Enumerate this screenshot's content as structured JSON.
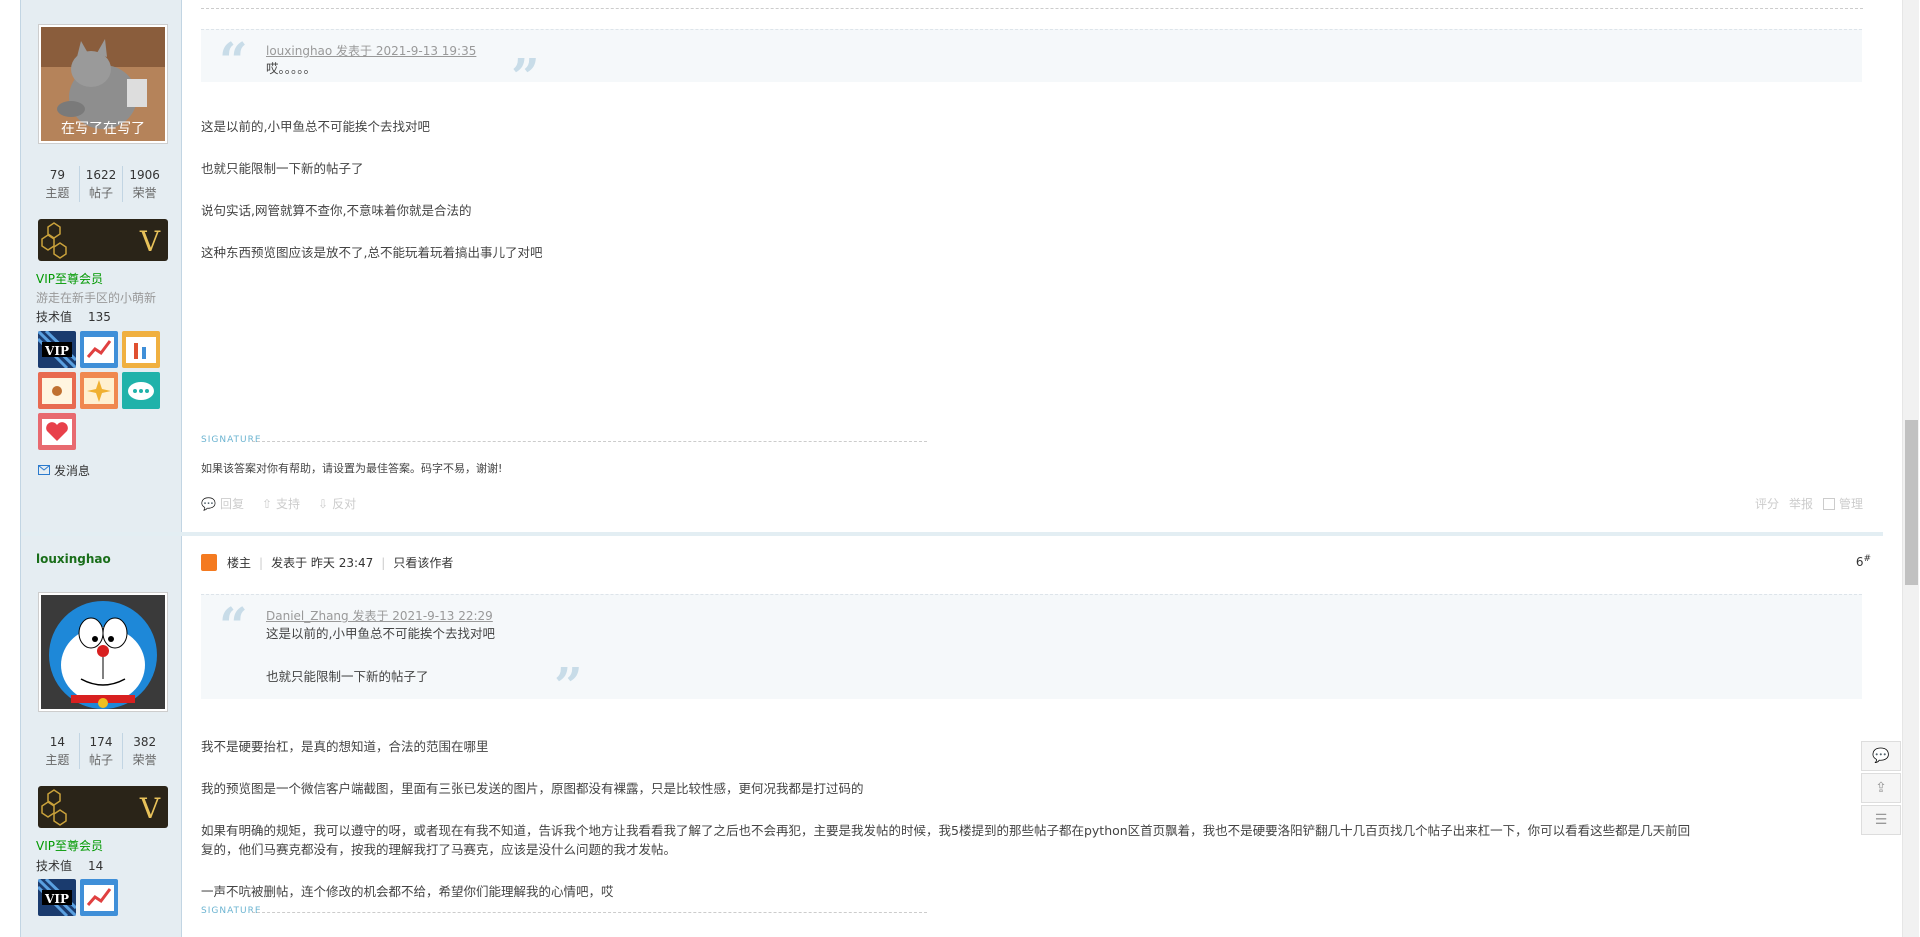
{
  "post_a": {
    "avatar_caption": "在写了在写了",
    "stats": [
      {
        "num": "79",
        "label": "主题"
      },
      {
        "num": "1622",
        "label": "帖子"
      },
      {
        "num": "1906",
        "label": "荣誉"
      }
    ],
    "vip_letter": "V",
    "group": "VIP至尊会员",
    "motto": "游走在新手区的小萌新",
    "tech_label": "技术值",
    "tech_value": "135",
    "medals": [
      "VIP",
      "chart",
      "rank",
      "tag",
      "star",
      "chat",
      "heart"
    ],
    "send_message": "发消息",
    "quote": {
      "header": "louxinghao 发表于 2021-9-13 19:35",
      "lines": [
        "哎。。。。。"
      ]
    },
    "paragraphs": [
      "这是以前的,小甲鱼总不可能挨个去找对吧",
      "也就只能限制一下新的帖子了",
      "说句实话,网管就算不查你,不意味着你就是合法的",
      "这种东西预览图应该是放不了,总不能玩着玩着搞出事儿了对吧"
    ],
    "signature_label": "SIGNATURE",
    "signature": "如果该答案对你有帮助，请设置为最佳答案。码字不易，谢谢!",
    "actions": {
      "reply": "回复",
      "support": "支持",
      "oppose": "反对",
      "rate": "评分",
      "report": "举报",
      "manage": "管理"
    }
  },
  "post_b": {
    "username": "louxinghao",
    "stats": [
      {
        "num": "14",
        "label": "主题"
      },
      {
        "num": "174",
        "label": "帖子"
      },
      {
        "num": "382",
        "label": "荣誉"
      }
    ],
    "vip_letter": "V",
    "group": "VIP至尊会员",
    "tech_label": "技术值",
    "tech_value": "14",
    "meta": {
      "role": "楼主",
      "posted": "发表于 昨天 23:47",
      "only_author": "只看该作者"
    },
    "floor": "6",
    "floor_mark": "#",
    "quote": {
      "header": "Daniel_Zhang 发表于 2021-9-13 22:29",
      "lines": [
        "这是以前的,小甲鱼总不可能挨个去找对吧",
        "也就只能限制一下新的帖子了"
      ]
    },
    "paragraphs": [
      "我不是硬要抬杠，是真的想知道，合法的范围在哪里",
      "我的预览图是一个微信客户端截图，里面有三张已发送的图片，原图都没有裸露，只是比较性感，更何况我都是打过码的",
      "如果有明确的规矩，我可以遵守的呀，或者现在有我不知道，告诉我个地方让我看看我了解了之后也不会再犯，主要是我发帖的时候，我5楼提到的那些帖子都在python区首页飘着，我也不是硬要洛阳铲翻几十几百页找几个帖子出来杠一下，你可以看看这些都是几天前回",
      "复的，他们马赛克都没有，按我的理解我打了马赛克，应该是没什么问题的我才发帖。",
      "一声不吭被删帖，连个修改的机会都不给，希望你们能理解我的心情吧，哎"
    ],
    "signature_label": "SIGNATURE"
  },
  "colors": {
    "accent": "#2b7acd",
    "group": "#009900",
    "sidebar": "#e5edf2"
  }
}
